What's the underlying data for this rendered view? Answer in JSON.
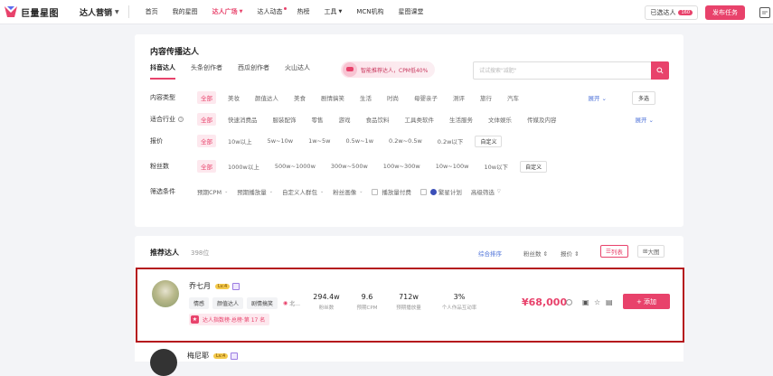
{
  "topbar": {
    "logo_text": "巨量星图",
    "product": "达人营销",
    "nav": [
      {
        "label": "首页"
      },
      {
        "label": "我的星图"
      },
      {
        "label": "达人广场"
      },
      {
        "label": "达人动态"
      },
      {
        "label": "热榜"
      },
      {
        "label": "工具"
      },
      {
        "label": "MCN机构"
      },
      {
        "label": "星图课堂"
      }
    ],
    "selected_label": "已选达人",
    "selected_count": "160",
    "publish_label": "发布任务"
  },
  "filters": {
    "title": "内容传播达人",
    "tabs": [
      "抖音达人",
      "头条创作者",
      "西瓜创作者",
      "火山达人"
    ],
    "smart_label": "智能推荐达人，CPM低40%",
    "search_placeholder": "试试搜索\"减肥\"",
    "content_type": {
      "label": "内容类型",
      "options": [
        "全部",
        "美妆",
        "颜值达人",
        "美食",
        "剧情搞笑",
        "生活",
        "时尚",
        "母婴亲子",
        "测评",
        "旅行",
        "汽车"
      ],
      "expand": "展开",
      "multi": "多选"
    },
    "industry": {
      "label": "适合行业",
      "options": [
        "全部",
        "快速消费品",
        "服装配饰",
        "零售",
        "游戏",
        "食品饮料",
        "工具类软件",
        "生活服务",
        "文体娱乐",
        "传媒及内容"
      ],
      "expand": "展开"
    },
    "price": {
      "label": "报价",
      "options": [
        "全部",
        "10w以上",
        "5w~10w",
        "1w~5w",
        "0.5w~1w",
        "0.2w~0.5w",
        "0.2w以下"
      ],
      "custom": "自定义"
    },
    "fans": {
      "label": "粉丝数",
      "options": [
        "全部",
        "1000w以上",
        "500w~1000w",
        "300w~500w",
        "100w~300w",
        "10w~100w",
        "10w以下"
      ],
      "custom": "自定义"
    },
    "conditions": {
      "label": "筛选条件",
      "selects": [
        "预期CPM",
        "预期播放量",
        "自定义人群包",
        "粉丝画像"
      ],
      "checks": [
        "播放量付费",
        "繁星计划"
      ],
      "advanced": "高级筛选"
    }
  },
  "recommend": {
    "title": "推荐达人",
    "count": "398位",
    "sort_active": "综合排序",
    "sort_fans": "粉丝数",
    "sort_price": "报价",
    "view_list": "列表",
    "view_big": "大图"
  },
  "kols": [
    {
      "name": "乔七月",
      "level": "Lv.4",
      "tags": [
        "情感",
        "颜值达人",
        "剧情搞笑"
      ],
      "more_tag": "北...",
      "rank": "达人指数榜·总榜·第 17 名",
      "stats": [
        {
          "value": "294.4w",
          "label": "粉丝数"
        },
        {
          "value": "9.6",
          "label": "预期CPM"
        },
        {
          "value": "712w",
          "label": "预期播放量"
        },
        {
          "value": "3%",
          "label": "个人作品互动率"
        }
      ],
      "price": "¥68,000",
      "add": "+ 添加"
    },
    {
      "name": "梅尼耶",
      "level": "Lv.4"
    }
  ],
  "colors": {
    "accent": "#e8426b",
    "link": "#4a6fd8",
    "highlight_border": "#b5161d"
  }
}
